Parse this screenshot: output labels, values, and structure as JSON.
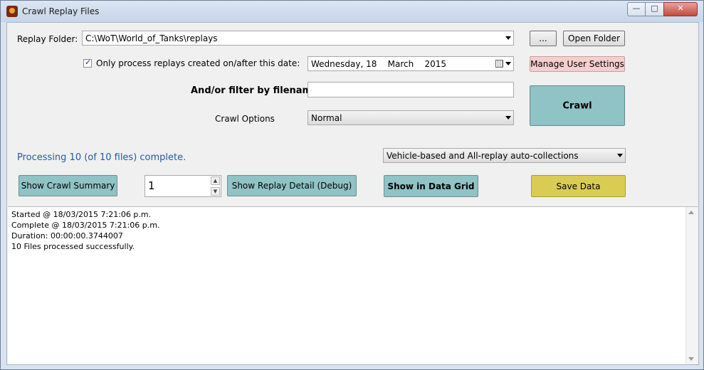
{
  "window": {
    "title": "Crawl Replay Files",
    "controls": {
      "minimize": "—",
      "maximize": "□",
      "close": "✕"
    }
  },
  "replay_folder": {
    "label": "Replay Folder:",
    "value": "C:\\WoT\\World_of_Tanks\\replays",
    "browse_label": "...",
    "open_folder_label": "Open Folder"
  },
  "date_filter": {
    "checkbox_label": "Only process replays created on/after this date:",
    "checked": true,
    "date_value": "Wednesday, 18    March    2015"
  },
  "manage_settings_label": "Manage User Settings",
  "filename_filter": {
    "label": "And/or filter by filename:",
    "value": ""
  },
  "crawl_options": {
    "label": "Crawl Options",
    "value": "Normal"
  },
  "crawl_button_label": "Crawl",
  "status_text": "Processing 10 (of 10 files) complete.",
  "collections_dropdown": {
    "value": "Vehicle-based and All-replay auto-collections"
  },
  "buttons": {
    "show_crawl_summary": "Show Crawl Summary",
    "spinner_value": "1",
    "show_replay_detail": "Show Replay Detail (Debug)",
    "show_in_data_grid": "Show in Data Grid",
    "save_data": "Save Data"
  },
  "log_lines": [
    "Started @ 18/03/2015 7:21:06 p.m.",
    "Complete @ 18/03/2015 7:21:06 p.m.",
    "Duration: 00:00:00.3744007",
    "10 Files processed successfully."
  ],
  "colors": {
    "teal_button": "#8fc3c6",
    "pink_button": "#f5cfcf",
    "yellow_button": "#d9cc52",
    "status_text": "#1f5aa8"
  },
  "icons": {
    "app": "game-app-icon",
    "calendar": "calendar-icon",
    "dropdown": "chevron-down-icon"
  }
}
